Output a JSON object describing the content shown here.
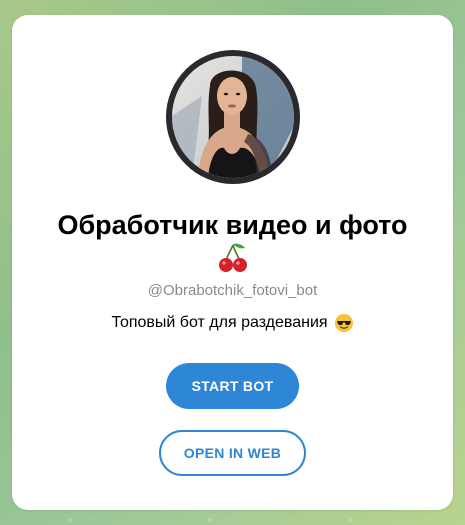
{
  "bot": {
    "name": "Обработчик видео и фото",
    "title_emoji": "cherries-icon",
    "username": "@Obrabotchik_fotovi_bot",
    "description": "Топовый бот для раздевания",
    "description_emoji": "sunglasses-face-icon"
  },
  "actions": {
    "start_label": "START BOT",
    "open_web_label": "OPEN IN WEB"
  },
  "colors": {
    "accent": "#2d86d6",
    "background_gradient_start": "#a9c98a",
    "background_gradient_end": "#b8d38d",
    "card": "#ffffff",
    "username": "#8a8a8a"
  }
}
